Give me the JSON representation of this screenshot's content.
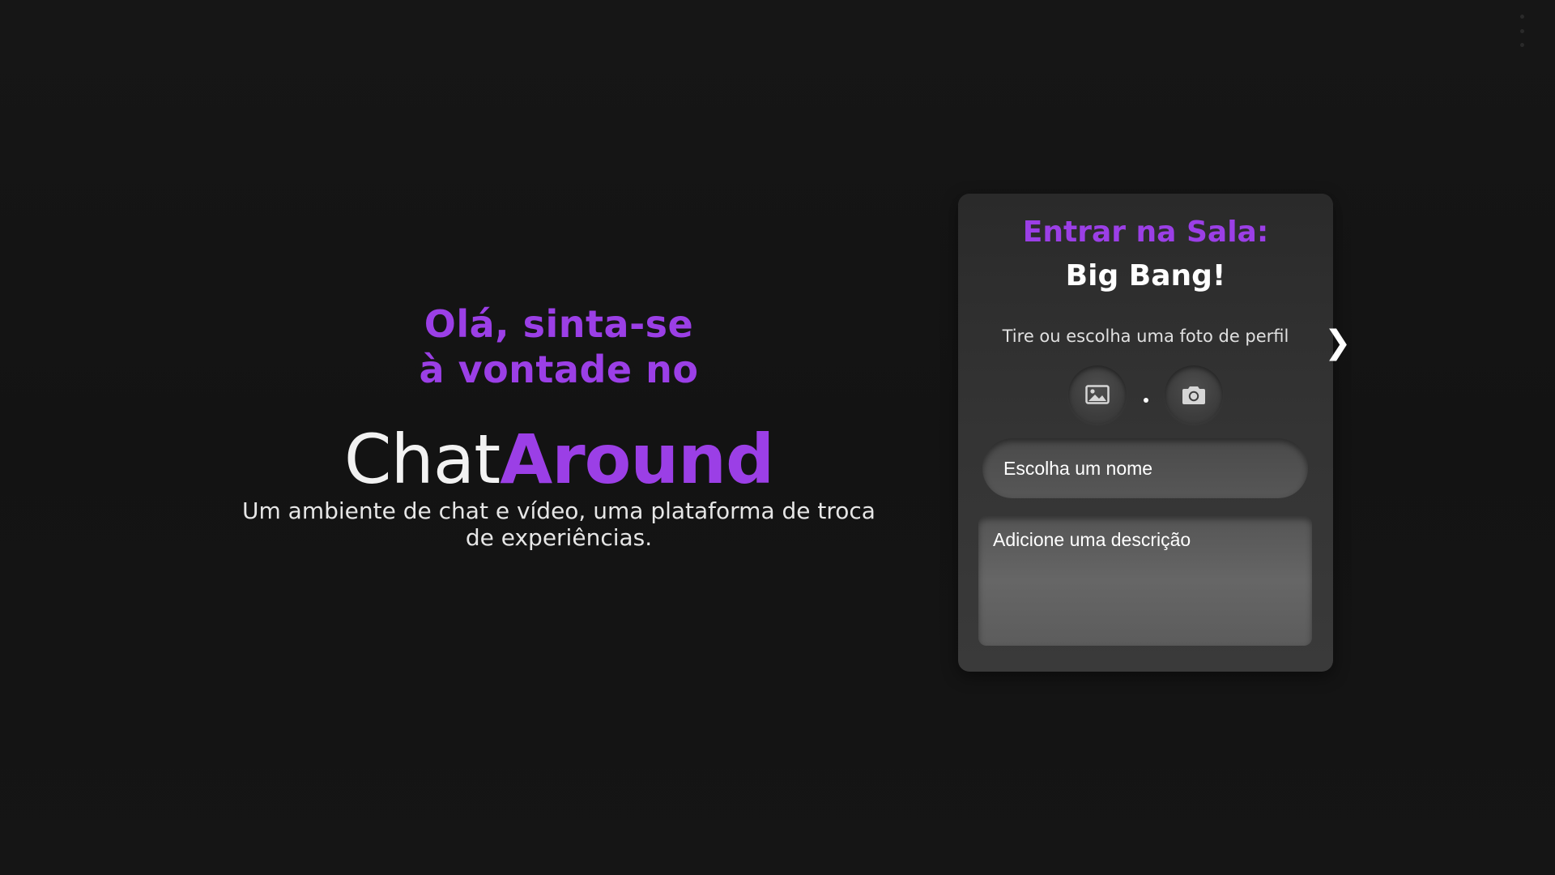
{
  "hero": {
    "greeting_line1": "Olá, sinta-se",
    "greeting_line2": "à vontade no",
    "brand_light": "Chat",
    "brand_strong": "Around",
    "tagline": "Um ambiente de chat e vídeo, uma plataforma de troca de experiências."
  },
  "card": {
    "title": "Entrar na Sala:",
    "room_name": "Big Bang!",
    "photo_hint": "Tire ou escolha uma foto de perfil",
    "next_arrow": "❯",
    "photo_separator": ".",
    "name_placeholder": "Escolha um nome",
    "description_placeholder": "Adicione uma descrição"
  },
  "icons": {
    "gallery": "image-icon",
    "camera": "camera-icon",
    "menu": "kebab-menu-icon"
  },
  "colors": {
    "accent": "#9b3fe6",
    "background": "#141414",
    "card": "#333333"
  }
}
